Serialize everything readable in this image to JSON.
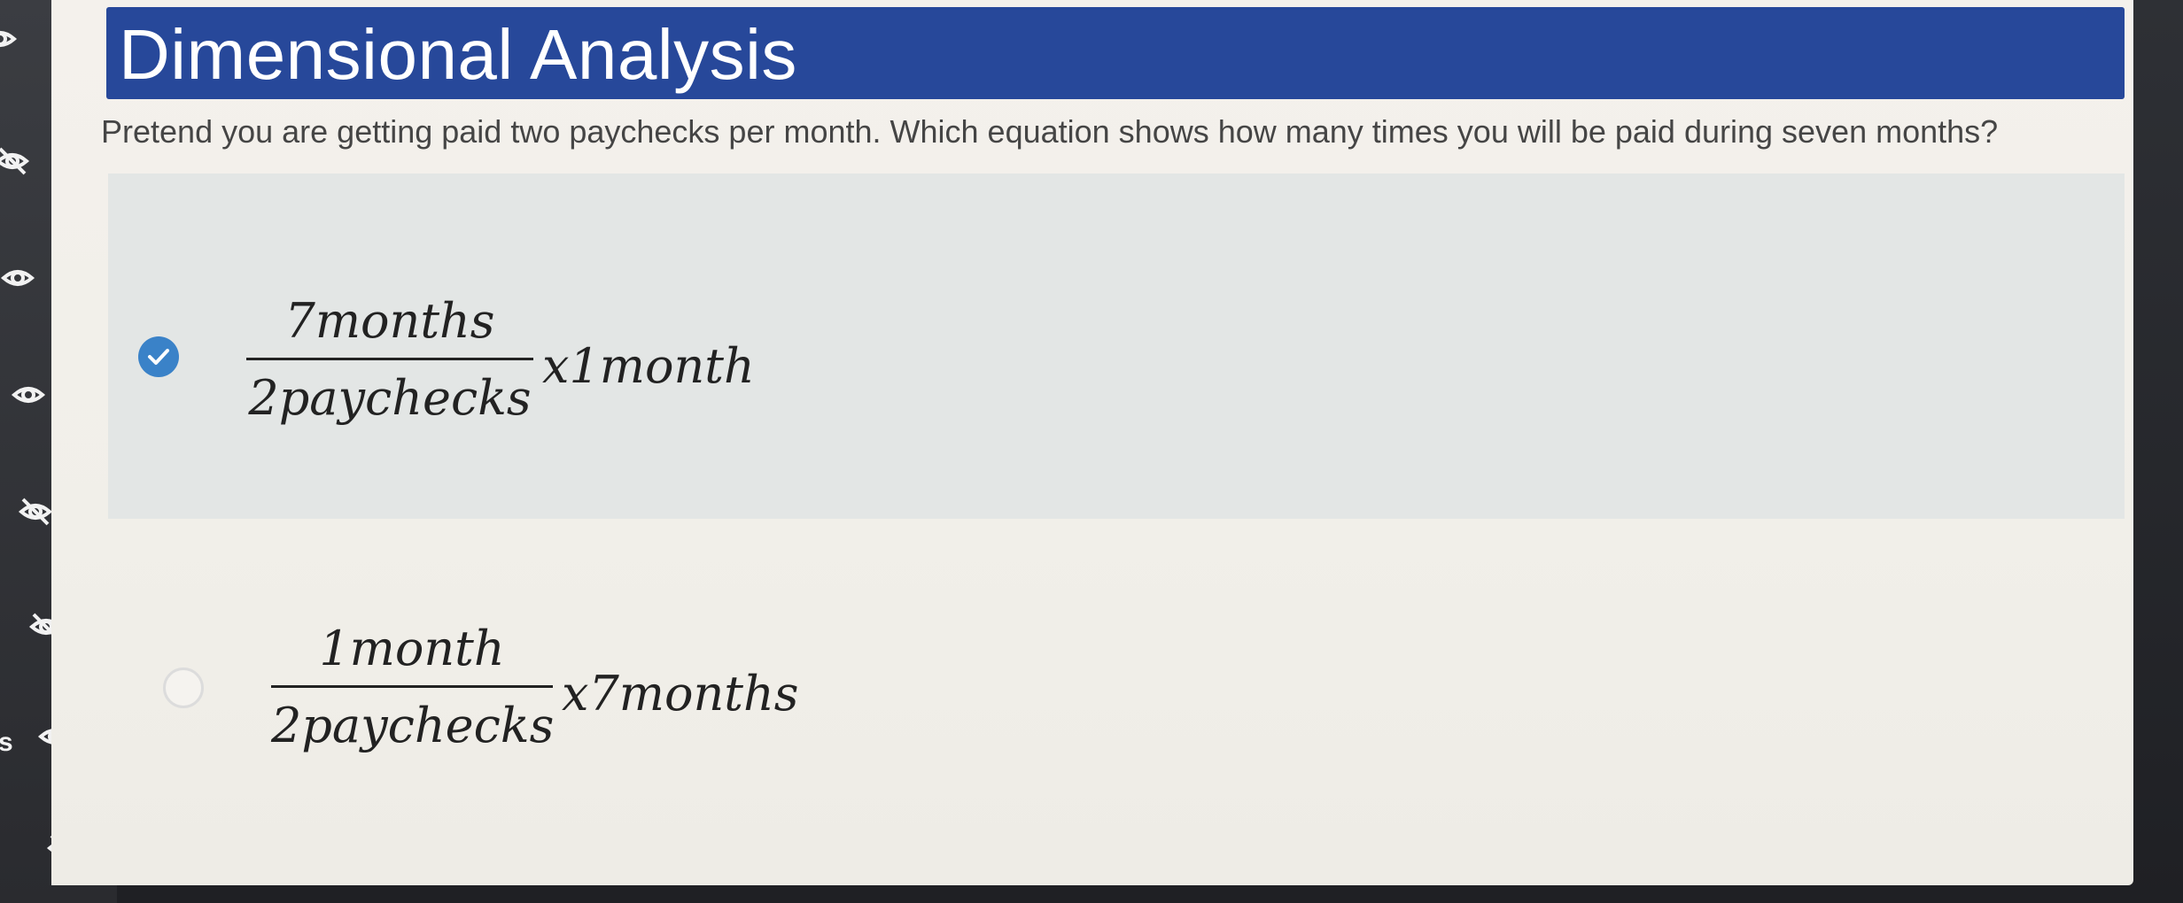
{
  "header": {
    "title": "Dimensional Analysis"
  },
  "question": {
    "text": "Pretend you are getting paid two paychecks per month. Which equation shows how many times you will be paid during seven months?"
  },
  "choices": [
    {
      "selected": true,
      "numerator": "7months",
      "denominator": "2paychecks",
      "tail": "x1month"
    },
    {
      "selected": false,
      "numerator": "1month",
      "denominator": "2paychecks",
      "tail": "x7months"
    }
  ],
  "sidebar": {
    "letter": "s",
    "icons": [
      "eye-half-icon",
      "eye-hidden-icon",
      "eye-icon",
      "eye-icon",
      "eye-hidden-icon",
      "eye-hidden-icon",
      "eye-icon",
      "eye-hidden-icon"
    ]
  },
  "colors": {
    "title_bar": "#27489a",
    "selected_bg": "#e3e6e5",
    "radio_checked": "#3a82c8"
  }
}
